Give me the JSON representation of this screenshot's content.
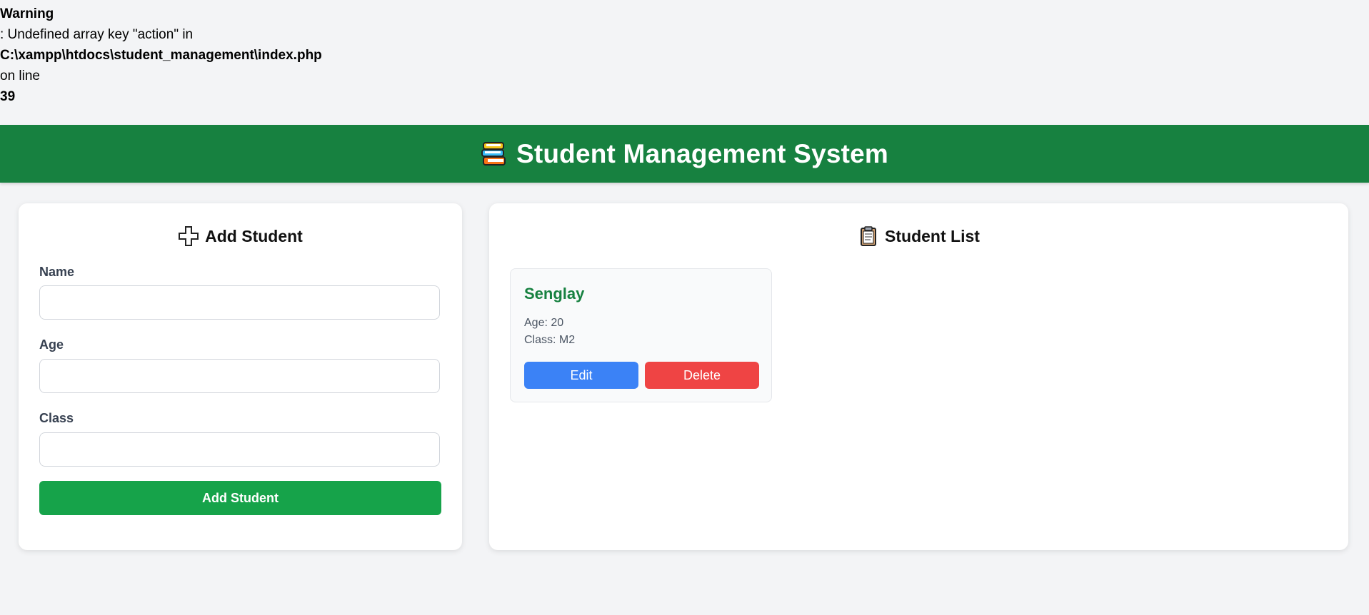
{
  "warning": {
    "heading": "Warning",
    "message": ": Undefined array key \"action\" in",
    "file": "C:\\xampp\\htdocs\\student_management\\index.php",
    "on_line_text": "on line",
    "line_number": "39"
  },
  "header": {
    "icon": "books-icon",
    "title": "Student Management System",
    "background_color": "#178140"
  },
  "add_panel": {
    "icon": "plus-icon",
    "title": "Add Student",
    "fields": [
      {
        "label": "Name",
        "value": "",
        "placeholder": ""
      },
      {
        "label": "Age",
        "value": "",
        "placeholder": ""
      },
      {
        "label": "Class",
        "value": "",
        "placeholder": ""
      }
    ],
    "submit_label": "Add Student",
    "submit_color": "#16a34a"
  },
  "list_panel": {
    "icon": "clipboard-icon",
    "title": "Student List",
    "students": [
      {
        "name": "Senglay",
        "age_text": "Age: 20",
        "class_text": "Class: M2",
        "edit_label": "Edit",
        "delete_label": "Delete"
      }
    ],
    "edit_color": "#3b82f6",
    "delete_color": "#ef4444"
  }
}
